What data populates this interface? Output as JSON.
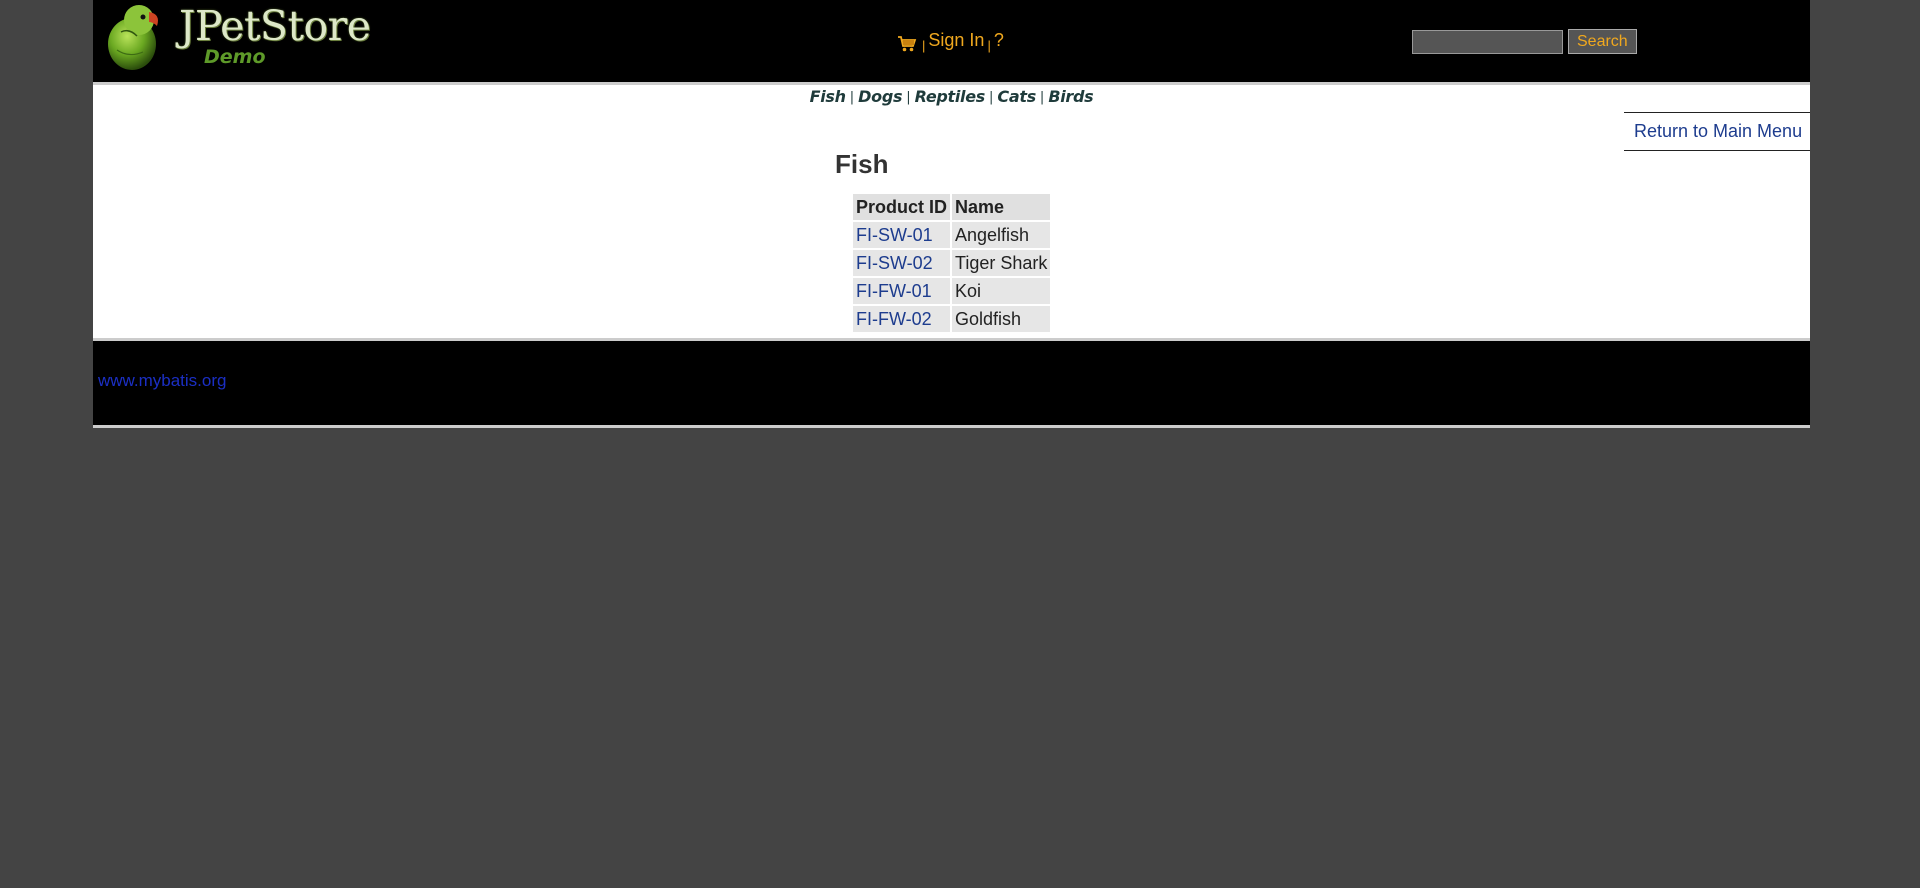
{
  "header": {
    "logo": {
      "brand": "JPetStore",
      "subtitle": "Demo"
    },
    "menu": {
      "cart_icon": "shopping-cart-icon",
      "sign_in_label": "Sign In",
      "help_label": "?",
      "separator": "|"
    },
    "search": {
      "value": "",
      "button_label": "Search"
    }
  },
  "quicklinks": [
    "Fish",
    "Dogs",
    "Reptiles",
    "Cats",
    "Birds"
  ],
  "back_link": "Return to Main Menu",
  "category": {
    "title": "Fish",
    "table": {
      "headers": [
        "Product ID",
        "Name"
      ],
      "rows": [
        {
          "id": "FI-SW-01",
          "name": "Angelfish"
        },
        {
          "id": "FI-SW-02",
          "name": "Tiger Shark"
        },
        {
          "id": "FI-FW-01",
          "name": "Koi"
        },
        {
          "id": "FI-FW-02",
          "name": "Goldfish"
        }
      ]
    }
  },
  "footer": {
    "link": "www.mybatis.org"
  },
  "colors": {
    "page_background": "#444444",
    "header_background": "#000000",
    "menu_text": "#f0a81e",
    "link_blue": "#1d3c8e",
    "footer_link": "#1b2fc4",
    "table_cell": "#e6e6e6"
  }
}
